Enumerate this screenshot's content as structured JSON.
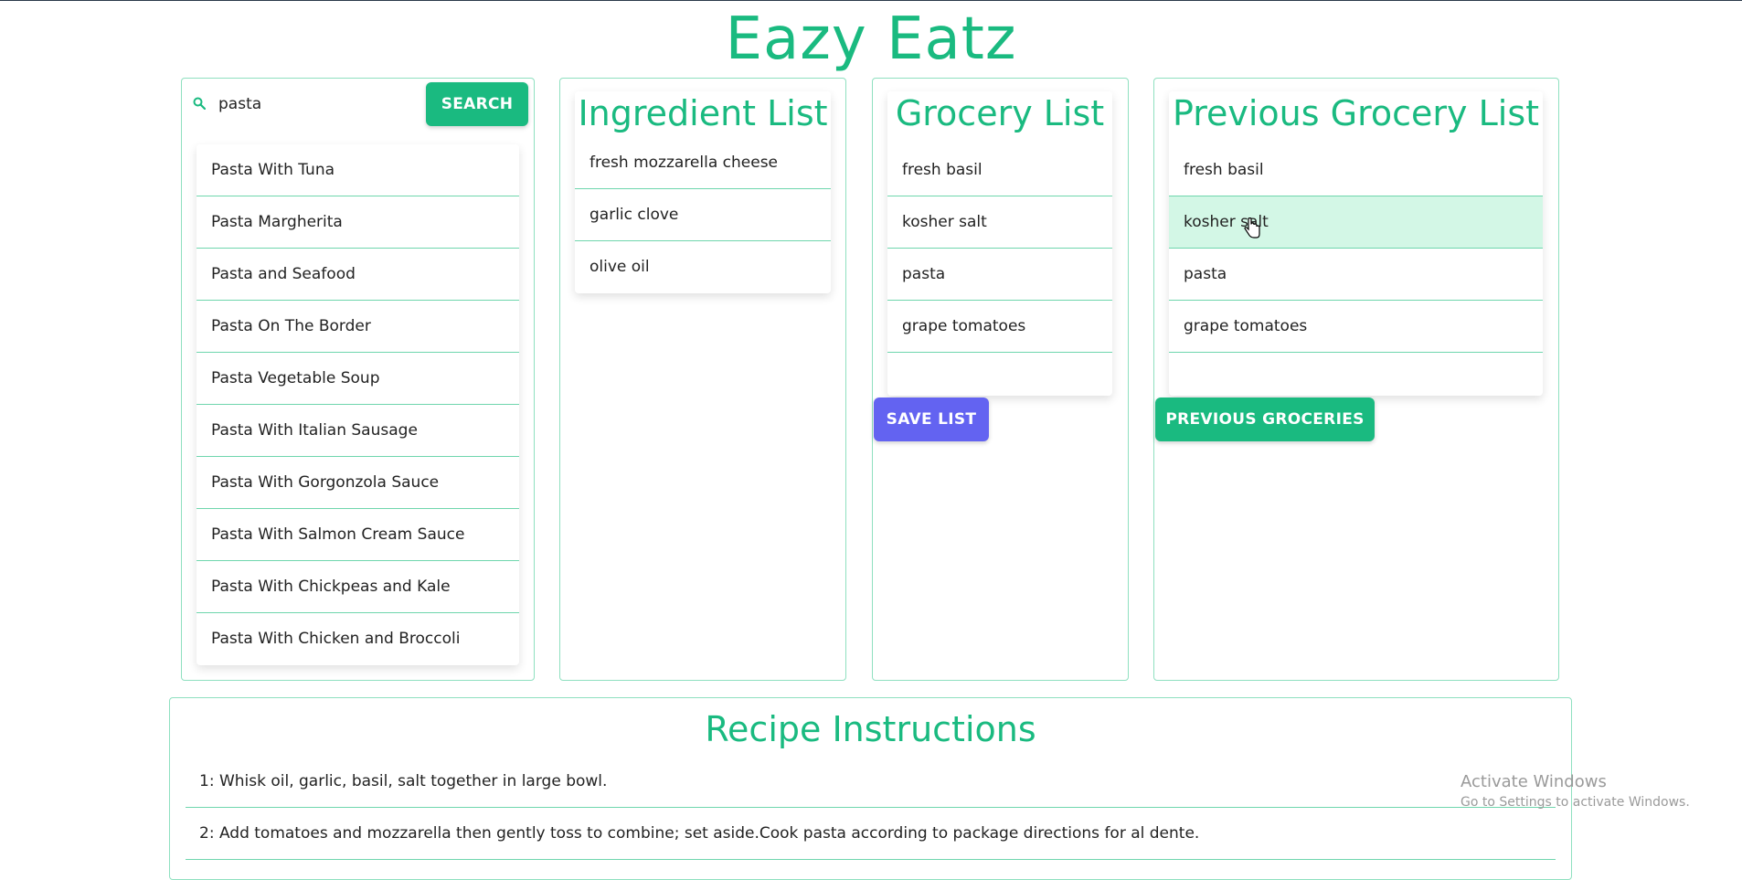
{
  "app": {
    "title": "Eazy Eatz"
  },
  "search": {
    "value": "pasta",
    "button_label": "SEARCH",
    "results": [
      "Pasta With Tuna",
      "Pasta Margherita",
      "Pasta and Seafood",
      "Pasta On The Border",
      "Pasta Vegetable Soup",
      "Pasta With Italian Sausage",
      "Pasta With Gorgonzola Sauce",
      "Pasta With Salmon Cream Sauce",
      "Pasta With Chickpeas and Kale",
      "Pasta With Chicken and Broccoli"
    ]
  },
  "ingredients": {
    "heading": "Ingredient List",
    "items": [
      "fresh mozzarella cheese",
      "garlic clove",
      "olive oil"
    ]
  },
  "grocery": {
    "heading": "Grocery List",
    "items": [
      "fresh basil",
      "kosher salt",
      "pasta",
      "grape tomatoes"
    ],
    "save_button_label": "SAVE LIST"
  },
  "previous": {
    "heading": "Previous Grocery List",
    "items": [
      "fresh basil",
      "kosher salt",
      "pasta",
      "grape tomatoes"
    ],
    "button_label": "PREVIOUS GROCERIES",
    "hovered_item": "kosher salt"
  },
  "instructions": {
    "heading": "Recipe Instructions",
    "steps": [
      "1: Whisk oil, garlic, basil, salt together in large bowl.",
      "2: Add tomatoes and mozzarella then gently toss to combine; set aside.Cook pasta according to package directions for al dente."
    ]
  },
  "watermark": {
    "line1": "Activate Windows",
    "line2": "Go to Settings to activate Windows."
  },
  "colors": {
    "accent": "#1aba80",
    "border": "#8fe0c0",
    "save_button": "#6363f1",
    "hover_row": "#d3f7e6"
  }
}
